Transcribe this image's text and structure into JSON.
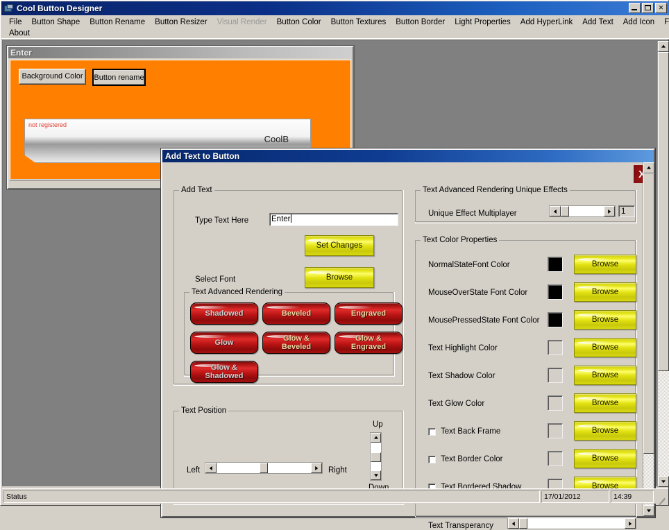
{
  "app": {
    "title": "Cool Button Designer",
    "icon": "app-window-icon",
    "window_controls": {
      "minimize": "_",
      "maximize": "□",
      "close": "✕"
    },
    "menu": {
      "row1": [
        {
          "label": "File",
          "disabled": false
        },
        {
          "label": "Button Shape",
          "disabled": false
        },
        {
          "label": "Button Rename",
          "disabled": false
        },
        {
          "label": "Button Resizer",
          "disabled": false
        },
        {
          "label": "Visual Render",
          "disabled": true
        },
        {
          "label": "Button Color",
          "disabled": false
        },
        {
          "label": "Button Textures",
          "disabled": false
        },
        {
          "label": "Button Border",
          "disabled": false
        },
        {
          "label": "Light Properties",
          "disabled": false
        },
        {
          "label": "Add HyperLink",
          "disabled": false
        },
        {
          "label": "Add Text",
          "disabled": false
        },
        {
          "label": "Add Icon",
          "disabled": false
        },
        {
          "label": "Feedback",
          "disabled": false
        }
      ],
      "row2": [
        {
          "label": "About",
          "disabled": false
        }
      ]
    }
  },
  "child_window": {
    "title": "Enter",
    "background_color": "#ff8000",
    "buttons": {
      "background_color": "Background  Color",
      "button_rename": "Button rename"
    },
    "preview": {
      "watermark": "not registered",
      "label": "CoolB"
    }
  },
  "dialog": {
    "title": "Add Text to Button",
    "close_label": "X",
    "close_color": "#941212",
    "add_text": {
      "caption": "Add Text",
      "type_text_label": "Type Text Here",
      "text_value": "Enter",
      "text_placeholder": "",
      "set_changes_label": "Set Changes",
      "select_font_label": "Select Font",
      "browse_label": "Browse"
    },
    "advanced_rendering": {
      "caption": "Text Advanced Rendering",
      "buttons": [
        {
          "label": "Shadowed",
          "style": "grey"
        },
        {
          "label": "Beveled",
          "style": "gold"
        },
        {
          "label": "Engraved",
          "style": "gold"
        },
        {
          "label": "Glow",
          "style": "grey"
        },
        {
          "label": "Glow &\nBeveled",
          "style": "gold"
        },
        {
          "label": "Glow &\nEngraved",
          "style": "gold"
        },
        {
          "label": "Glow &\nShadowed",
          "style": "grey"
        }
      ]
    },
    "text_position": {
      "caption": "Text Position",
      "left_label": "Left",
      "right_label": "Right",
      "up_label": "Up",
      "down_label": "Down"
    },
    "unique_effects": {
      "caption": "Text Advanced Rendering Unique Effects",
      "multiplayer_label": "Unique Effect Multiplayer",
      "multiplayer_value": "1"
    },
    "color_properties": {
      "caption": "Text Color Properties",
      "browse_label": "Browse",
      "transparency_label": "Text Transperancy",
      "rows": [
        {
          "label": "NormalStateFont Color",
          "swatch": "#000000",
          "checkbox": false
        },
        {
          "label": "MouseOverState Font Color",
          "swatch": "#000000",
          "checkbox": false
        },
        {
          "label": "MousePressedState Font Color",
          "swatch": "#000000",
          "checkbox": false
        },
        {
          "label": "Text Highlight Color",
          "swatch": "#d4d0c8",
          "checkbox": false
        },
        {
          "label": "Text Shadow Color",
          "swatch": "#d4d0c8",
          "checkbox": false
        },
        {
          "label": "Text Glow Color",
          "swatch": "#d4d0c8",
          "checkbox": false
        },
        {
          "label": "Text Back Frame",
          "swatch": "#d4d0c8",
          "checkbox": true,
          "checked": false
        },
        {
          "label": "Text Border Color",
          "swatch": "#d4d0c8",
          "checkbox": true,
          "checked": false
        },
        {
          "label": "Text Bordered Shadow",
          "swatch": "#d4d0c8",
          "checkbox": true,
          "checked": false
        }
      ]
    }
  },
  "statusbar": {
    "status": "Status",
    "date": "17/01/2012",
    "time": "14:39"
  }
}
